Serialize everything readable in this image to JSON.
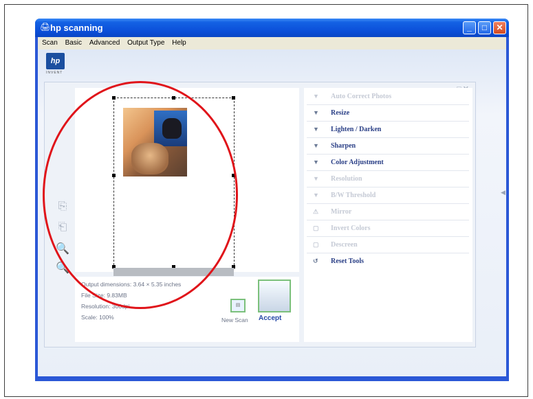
{
  "window": {
    "title": "hp scanning"
  },
  "menu": [
    "Scan",
    "Basic",
    "Advanced",
    "Output Type",
    "Help"
  ],
  "logo": {
    "text": "hp",
    "sub": "INVENT"
  },
  "info": {
    "dimensions": "Output dimensions: 3.64 × 5.35 inches",
    "file_size": "File Size: 9.83MB",
    "resolution": "Resolution: 300dpi",
    "scale": "Scale: 100%"
  },
  "buttons": {
    "new_scan": "New Scan",
    "accept": "Accept"
  },
  "tools": [
    {
      "label": "Auto Correct Photos",
      "state": "disabled",
      "glyph": "▼"
    },
    {
      "label": "Resize",
      "state": "active",
      "glyph": "▼"
    },
    {
      "label": "Lighten / Darken",
      "state": "active",
      "glyph": "▼"
    },
    {
      "label": "Sharpen",
      "state": "active",
      "glyph": "▼"
    },
    {
      "label": "Color Adjustment",
      "state": "active",
      "glyph": "▼"
    },
    {
      "label": "Resolution",
      "state": "disabled",
      "glyph": "▼"
    },
    {
      "label": "B/W Threshold",
      "state": "disabled",
      "glyph": "▼"
    },
    {
      "label": "Mirror",
      "state": "disabled",
      "glyph": "⚠"
    },
    {
      "label": "Invert Colors",
      "state": "disabled",
      "glyph": "▢"
    },
    {
      "label": "Descreen",
      "state": "disabled",
      "glyph": "▢"
    },
    {
      "label": "Reset Tools",
      "state": "active",
      "glyph": "↺"
    }
  ],
  "colors": {
    "title_bar": "#0b4ed8",
    "annotation": "#e0141a",
    "tool_active": "#2a3f86"
  }
}
